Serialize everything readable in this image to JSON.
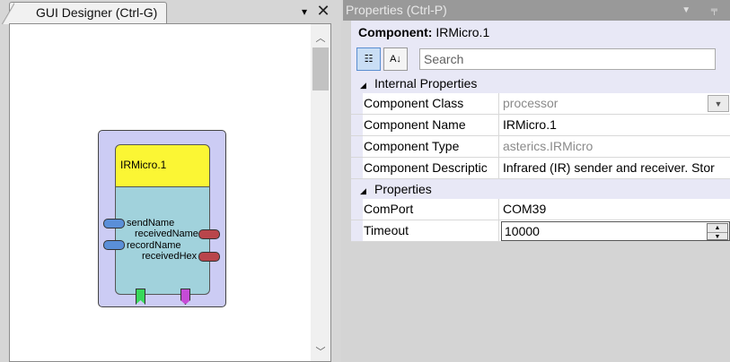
{
  "designer": {
    "tab_label": "GUI Designer (Ctrl-G)",
    "component": {
      "title": "IRMicro.1",
      "inputs": [
        {
          "label": "sendName"
        },
        {
          "label": "recordName"
        }
      ],
      "outputs": [
        {
          "label": "receivedName"
        },
        {
          "label": "receivedHex"
        }
      ]
    }
  },
  "properties": {
    "panel_title": "Properties (Ctrl-P)",
    "component_label": "Component:",
    "component_name": "IRMicro.1",
    "search_placeholder": "Search",
    "categories": [
      {
        "label": "Internal Properties",
        "rows": [
          {
            "name": "Component Class",
            "value": "processor",
            "readonly": true
          },
          {
            "name": "Component Name",
            "value": "IRMicro.1",
            "readonly": false
          },
          {
            "name": "Component Type",
            "value": "asterics.IRMicro",
            "readonly": true
          },
          {
            "name": "Component Descriptic",
            "value": "Infrared (IR) sender and receiver. Stor",
            "readonly": false
          }
        ]
      },
      {
        "label": "Properties",
        "rows": [
          {
            "name": "ComPort",
            "value": "COM39"
          },
          {
            "name": "Timeout",
            "value": "10000"
          }
        ]
      }
    ]
  },
  "colors": {
    "component_title_bg": "#fbf634",
    "component_body_bg": "#a1d2dc",
    "component_frame_bg": "#ccccf4",
    "input_port": "#5a8fd8",
    "output_port": "#b9454b",
    "event_listener": "#38d85a",
    "event_trigger": "#c54bd6"
  }
}
